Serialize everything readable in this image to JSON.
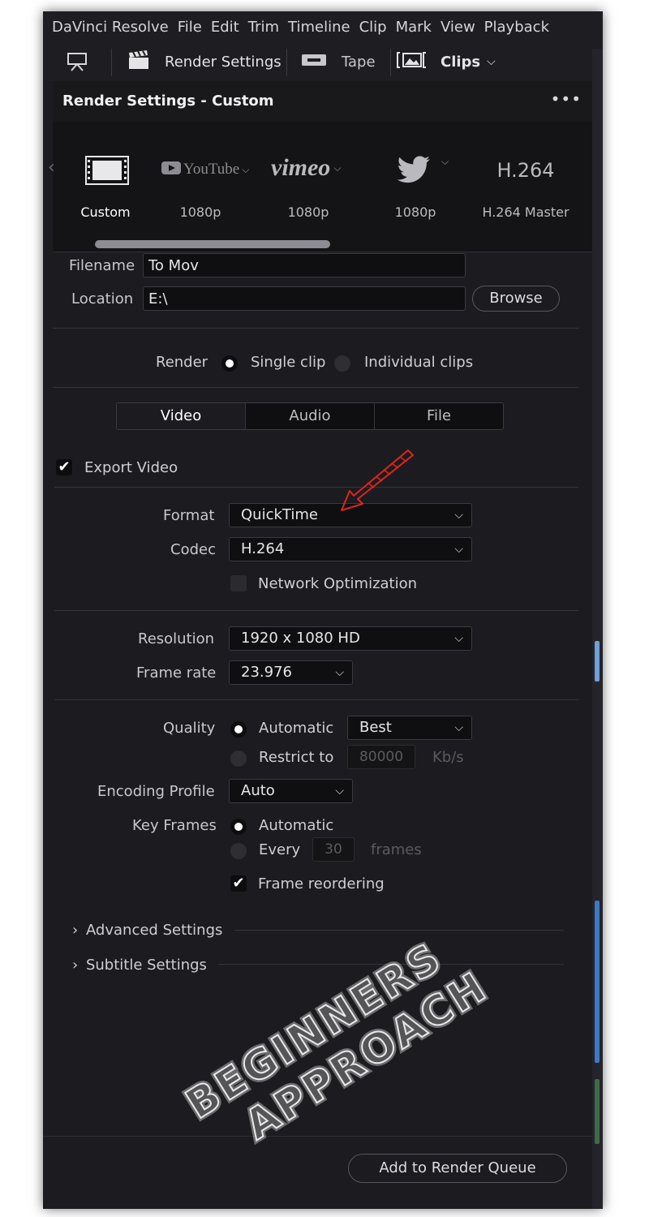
{
  "menubar": {
    "items": [
      "DaVinci Resolve",
      "File",
      "Edit",
      "Trim",
      "Timeline",
      "Clip",
      "Mark",
      "View",
      "Playback"
    ]
  },
  "toolbar": {
    "render_settings_label": "Render Settings",
    "tape_label": "Tape",
    "clips_label": "Clips"
  },
  "panel": {
    "title": "Render Settings - Custom",
    "more": "•••"
  },
  "presets": [
    {
      "logo": "",
      "label": "Custom"
    },
    {
      "logo": "YouTube",
      "label": "1080p"
    },
    {
      "logo": "vimeo",
      "label": "1080p"
    },
    {
      "logo": "",
      "label": "1080p"
    },
    {
      "logo": "H.264",
      "label": "H.264 Master"
    }
  ],
  "file": {
    "filename_label": "Filename",
    "filename_value": "To Mov",
    "location_label": "Location",
    "location_value": "E:\\",
    "browse_label": "Browse"
  },
  "render": {
    "label": "Render",
    "single_clip": "Single clip",
    "individual_clips": "Individual clips"
  },
  "tabs": [
    "Video",
    "Audio",
    "File"
  ],
  "video": {
    "export_video": "Export Video",
    "format_label": "Format",
    "format_value": "QuickTime",
    "codec_label": "Codec",
    "codec_value": "H.264",
    "network_optimization": "Network Optimization",
    "resolution_label": "Resolution",
    "resolution_value": "1920 x 1080 HD",
    "framerate_label": "Frame rate",
    "framerate_value": "23.976",
    "quality_label": "Quality",
    "quality_auto": "Automatic",
    "quality_auto_value": "Best",
    "quality_restrict": "Restrict to",
    "quality_restrict_value": "80000",
    "quality_unit": "Kb/s",
    "encoding_label": "Encoding Profile",
    "encoding_value": "Auto",
    "keyframes_label": "Key Frames",
    "keyframes_auto": "Automatic",
    "keyframes_every": "Every",
    "keyframes_every_value": "30",
    "keyframes_unit": "frames",
    "frame_reordering": "Frame reordering"
  },
  "sections": {
    "advanced": "Advanced Settings",
    "subtitle": "Subtitle Settings"
  },
  "footer": {
    "add_to_queue": "Add to Render Queue"
  },
  "watermark": {
    "line1": "BEGINNERS",
    "line2": "APPROACH"
  },
  "colors": {
    "panel_bg": "#1c1c20",
    "field_bg": "#0f0f11",
    "arrow": "#e0251b"
  },
  "icons": [
    "monitor-stand-icon",
    "clapperboard-icon",
    "tape-icon",
    "clips-icon",
    "film-strip-icon",
    "youtube-play-icon",
    "twitter-bird-icon",
    "chevron-down-icon",
    "chevron-right-icon",
    "check-icon"
  ]
}
